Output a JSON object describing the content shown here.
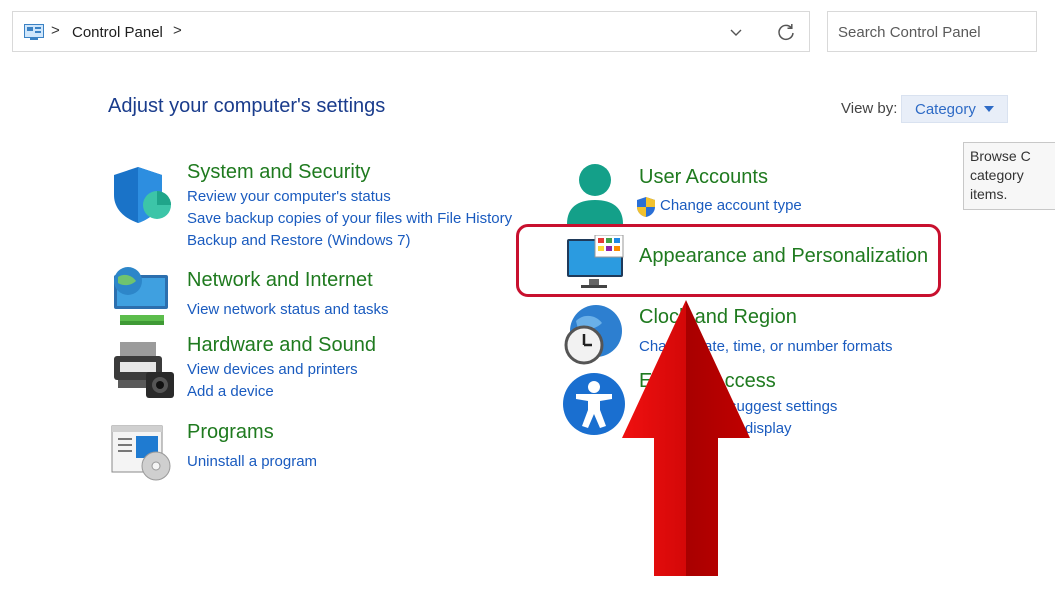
{
  "address_bar": {
    "breadcrumb": "Control Panel",
    "separator": ">"
  },
  "search": {
    "placeholder": "Search Control Panel"
  },
  "heading": "Adjust your computer's settings",
  "view_by": {
    "label": "View by:",
    "value": "Category"
  },
  "tooltip": {
    "text": "Browse C category items."
  },
  "categories": {
    "system_security": {
      "title": "System and Security",
      "links": [
        "Review your computer's status",
        "Save backup copies of your files with File History",
        "Backup and Restore (Windows 7)"
      ],
      "icon": "shield-icon"
    },
    "network_internet": {
      "title": "Network and Internet",
      "links": [
        "View network status and tasks"
      ],
      "icon": "globe-monitor-icon"
    },
    "hardware_sound": {
      "title": "Hardware and Sound",
      "links": [
        "View devices and printers",
        "Add a device"
      ],
      "icon": "printer-icon"
    },
    "programs": {
      "title": "Programs",
      "links": [
        "Uninstall a program"
      ],
      "icon": "programs-disc-icon"
    },
    "user_accounts": {
      "title": "User Accounts",
      "links": [
        "Change account type"
      ],
      "icon": "user-icon"
    },
    "appearance": {
      "title": "Appearance and Personalization",
      "icon": "monitor-palette-icon"
    },
    "clock_region": {
      "title": "Clock and Region",
      "links": [
        "Change date, time, or number formats"
      ],
      "icon": "clock-globe-icon"
    },
    "ease_access": {
      "title": "Ease of Access",
      "links": [
        "Let Windows suggest settings",
        "Optimize visual display"
      ],
      "icon": "accessibility-icon"
    }
  },
  "colors": {
    "highlight": "#c8102e",
    "arrow": "#d10a0a",
    "title_green": "#1f7a1f",
    "link_blue": "#1a5bbf"
  }
}
